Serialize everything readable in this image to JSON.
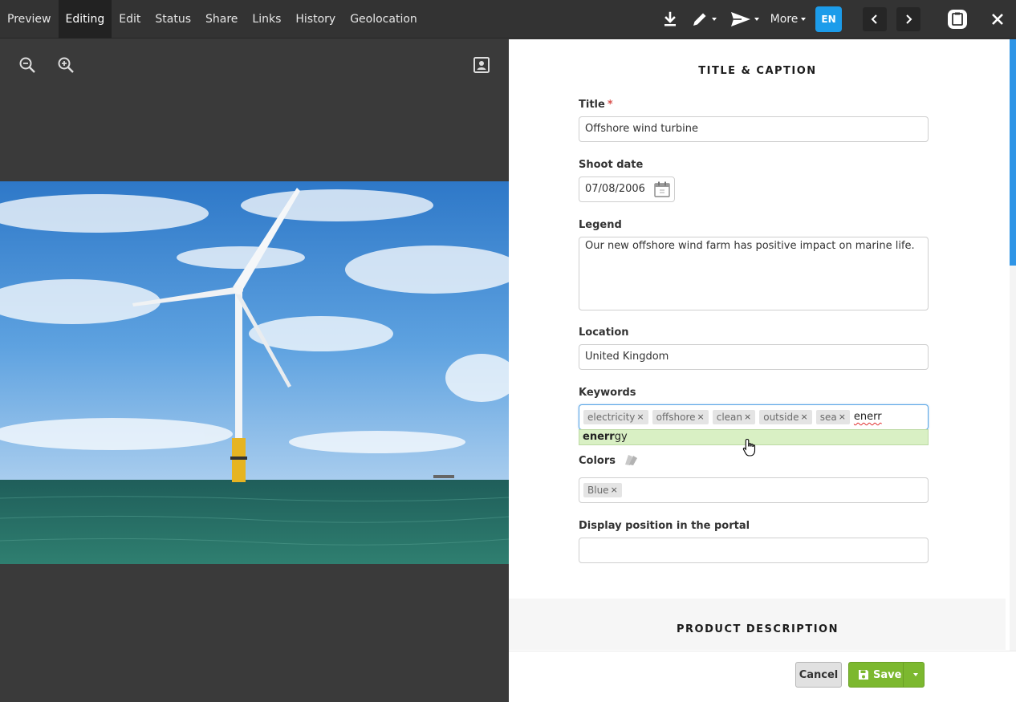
{
  "nav": {
    "tabs": [
      {
        "label": "Preview",
        "active": false
      },
      {
        "label": "Editing",
        "active": true
      },
      {
        "label": "Edit",
        "active": false
      },
      {
        "label": "Status",
        "active": false
      },
      {
        "label": "Share",
        "active": false
      },
      {
        "label": "Links",
        "active": false
      },
      {
        "label": "History",
        "active": false
      },
      {
        "label": "Geolocation",
        "active": false
      }
    ]
  },
  "toolbar": {
    "download_icon": "download-icon",
    "edit_icon": "pencil-icon",
    "send_icon": "send-icon",
    "more_label": "More",
    "language": "EN",
    "prev_icon": "chevron-left-icon",
    "next_icon": "chevron-right-icon",
    "clipboard_icon": "clipboard-icon",
    "close_icon": "close-icon"
  },
  "viewer": {
    "zoom_out_icon": "zoom-out-icon",
    "zoom_in_icon": "zoom-in-icon",
    "toggle_icon": "portrait-icon"
  },
  "form": {
    "section_title": "TITLE & CAPTION",
    "title": {
      "label": "Title",
      "required_mark": "*",
      "value": "Offshore wind turbine"
    },
    "shoot_date": {
      "label": "Shoot date",
      "value": "07/08/2006"
    },
    "legend": {
      "label": "Legend",
      "value": "Our new offshore wind farm has positive impact on marine life."
    },
    "location": {
      "label": "Location",
      "value": "United Kingdom"
    },
    "keywords": {
      "label": "Keywords",
      "tags": [
        "electricity",
        "offshore",
        "clean",
        "outside",
        "sea"
      ],
      "typed": "enerr",
      "suggestion_match": "enerr",
      "suggestion_rest": "gy"
    },
    "colors": {
      "label": "Colors",
      "tags": [
        "Blue"
      ]
    },
    "display_position": {
      "label": "Display position in the portal",
      "value": ""
    },
    "product_section_title": "PRODUCT DESCRIPTION"
  },
  "footer": {
    "cancel_label": "Cancel",
    "save_label": "Save"
  },
  "colors": {
    "topbar": "#333333",
    "accent_blue": "#1c9cea",
    "save_green": "#7cb82f",
    "suggestion_bg": "#d9f0c4"
  }
}
